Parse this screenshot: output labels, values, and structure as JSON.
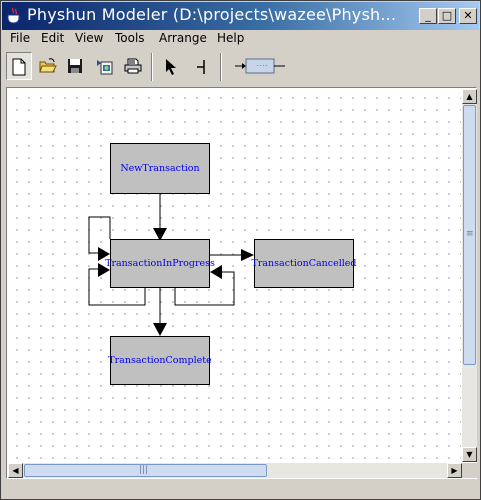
{
  "window": {
    "title": "Physhun Modeler (D:\\projects\\wazee\\Physh...",
    "minimize_glyph": "_",
    "maximize_glyph": "□",
    "close_glyph": "✕"
  },
  "menu": {
    "file": "File",
    "edit": "Edit",
    "view": "View",
    "tools": "Tools",
    "arrange": "Arrange",
    "help": "Help"
  },
  "toolbar": {
    "buttons": [
      "new-document-icon",
      "open-folder-icon",
      "save-disk-icon",
      "export-image-icon",
      "print-icon",
      "select-arrow-icon",
      "transition-tool-icon",
      "state-tool-icon"
    ],
    "state_tool_caption": "----"
  },
  "diagram": {
    "states": [
      {
        "id": "new",
        "label": "NewTransaction"
      },
      {
        "id": "inprogress",
        "label": "TransactionInProgress"
      },
      {
        "id": "cancelled",
        "label": "TransactionCancelled"
      },
      {
        "id": "complete",
        "label": "TransactionComplete"
      }
    ]
  },
  "scrollbars": {
    "up_glyph": "▲",
    "down_glyph": "▼",
    "left_glyph": "◀",
    "right_glyph": "▶",
    "vertical_grip": "≡",
    "horizontal_grip": "|||"
  },
  "colors": {
    "title_gradient_start": "#0a246a",
    "title_gradient_end": "#a6caf0",
    "state_fill": "#c0c0c0",
    "state_text": "#0000ee",
    "scroll_thumb": "#cfdcef"
  }
}
